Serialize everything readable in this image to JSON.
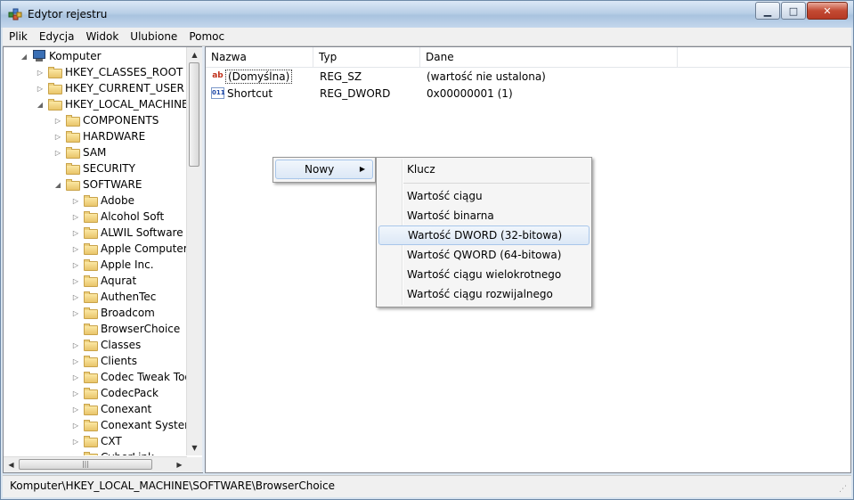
{
  "window": {
    "title": "Edytor rejestru"
  },
  "menubar": [
    "Plik",
    "Edycja",
    "Widok",
    "Ulubione",
    "Pomoc"
  ],
  "tree": [
    {
      "label": "Komputer",
      "level": 0,
      "toggle": "expanded",
      "icon": "computer-icon"
    },
    {
      "label": "HKEY_CLASSES_ROOT",
      "level": 1,
      "toggle": "collapsed",
      "icon": "folder-icon"
    },
    {
      "label": "HKEY_CURRENT_USER",
      "level": 1,
      "toggle": "collapsed",
      "icon": "folder-icon"
    },
    {
      "label": "HKEY_LOCAL_MACHINE",
      "level": 1,
      "toggle": "expanded",
      "icon": "folder-icon"
    },
    {
      "label": "COMPONENTS",
      "level": 2,
      "toggle": "collapsed",
      "icon": "folder-icon"
    },
    {
      "label": "HARDWARE",
      "level": 2,
      "toggle": "collapsed",
      "icon": "folder-icon"
    },
    {
      "label": "SAM",
      "level": 2,
      "toggle": "collapsed",
      "icon": "folder-icon"
    },
    {
      "label": "SECURITY",
      "level": 2,
      "toggle": "none",
      "icon": "folder-icon"
    },
    {
      "label": "SOFTWARE",
      "level": 2,
      "toggle": "expanded",
      "icon": "folder-icon"
    },
    {
      "label": "Adobe",
      "level": 3,
      "toggle": "collapsed",
      "icon": "folder-icon"
    },
    {
      "label": "Alcohol Soft",
      "level": 3,
      "toggle": "collapsed",
      "icon": "folder-icon"
    },
    {
      "label": "ALWIL Software",
      "level": 3,
      "toggle": "collapsed",
      "icon": "folder-icon"
    },
    {
      "label": "Apple Computer, I",
      "level": 3,
      "toggle": "collapsed",
      "icon": "folder-icon"
    },
    {
      "label": "Apple Inc.",
      "level": 3,
      "toggle": "collapsed",
      "icon": "folder-icon"
    },
    {
      "label": "Aqurat",
      "level": 3,
      "toggle": "collapsed",
      "icon": "folder-icon"
    },
    {
      "label": "AuthenTec",
      "level": 3,
      "toggle": "collapsed",
      "icon": "folder-icon"
    },
    {
      "label": "Broadcom",
      "level": 3,
      "toggle": "collapsed",
      "icon": "folder-icon"
    },
    {
      "label": "BrowserChoice",
      "level": 3,
      "toggle": "none",
      "icon": "folder-icon"
    },
    {
      "label": "Classes",
      "level": 3,
      "toggle": "collapsed",
      "icon": "folder-icon"
    },
    {
      "label": "Clients",
      "level": 3,
      "toggle": "collapsed",
      "icon": "folder-icon"
    },
    {
      "label": "Codec Tweak Too",
      "level": 3,
      "toggle": "collapsed",
      "icon": "folder-icon"
    },
    {
      "label": "CodecPack",
      "level": 3,
      "toggle": "collapsed",
      "icon": "folder-icon"
    },
    {
      "label": "Conexant",
      "level": 3,
      "toggle": "collapsed",
      "icon": "folder-icon"
    },
    {
      "label": "Conexant Systems",
      "level": 3,
      "toggle": "collapsed",
      "icon": "folder-icon"
    },
    {
      "label": "CXT",
      "level": 3,
      "toggle": "collapsed",
      "icon": "folder-icon"
    },
    {
      "label": "CyberLink",
      "level": 3,
      "toggle": "collapsed",
      "icon": "folder-icon"
    }
  ],
  "list": {
    "columns": [
      "Nazwa",
      "Typ",
      "Dane"
    ],
    "rows": [
      {
        "name": "(Domyślna)",
        "type": "REG_SZ",
        "data": "(wartość nie ustalona)",
        "icon": "string-value-icon"
      },
      {
        "name": "Shortcut",
        "type": "REG_DWORD",
        "data": "0x00000001 (1)",
        "icon": "binary-value-icon"
      }
    ]
  },
  "context_menu": {
    "label": "Nowy"
  },
  "submenu": {
    "items": [
      {
        "label": "Klucz",
        "highlighted": false
      },
      {
        "label": "Wartość ciągu",
        "highlighted": false
      },
      {
        "label": "Wartość binarna",
        "highlighted": false
      },
      {
        "label": "Wartość DWORD (32-bitowa)",
        "highlighted": true
      },
      {
        "label": "Wartość QWORD (64-bitowa)",
        "highlighted": false
      },
      {
        "label": "Wartość ciągu wielokrotnego",
        "highlighted": false
      },
      {
        "label": "Wartość ciągu rozwijalnego",
        "highlighted": false
      }
    ]
  },
  "statusbar": {
    "path": "Komputer\\HKEY_LOCAL_MACHINE\\SOFTWARE\\BrowserChoice"
  }
}
